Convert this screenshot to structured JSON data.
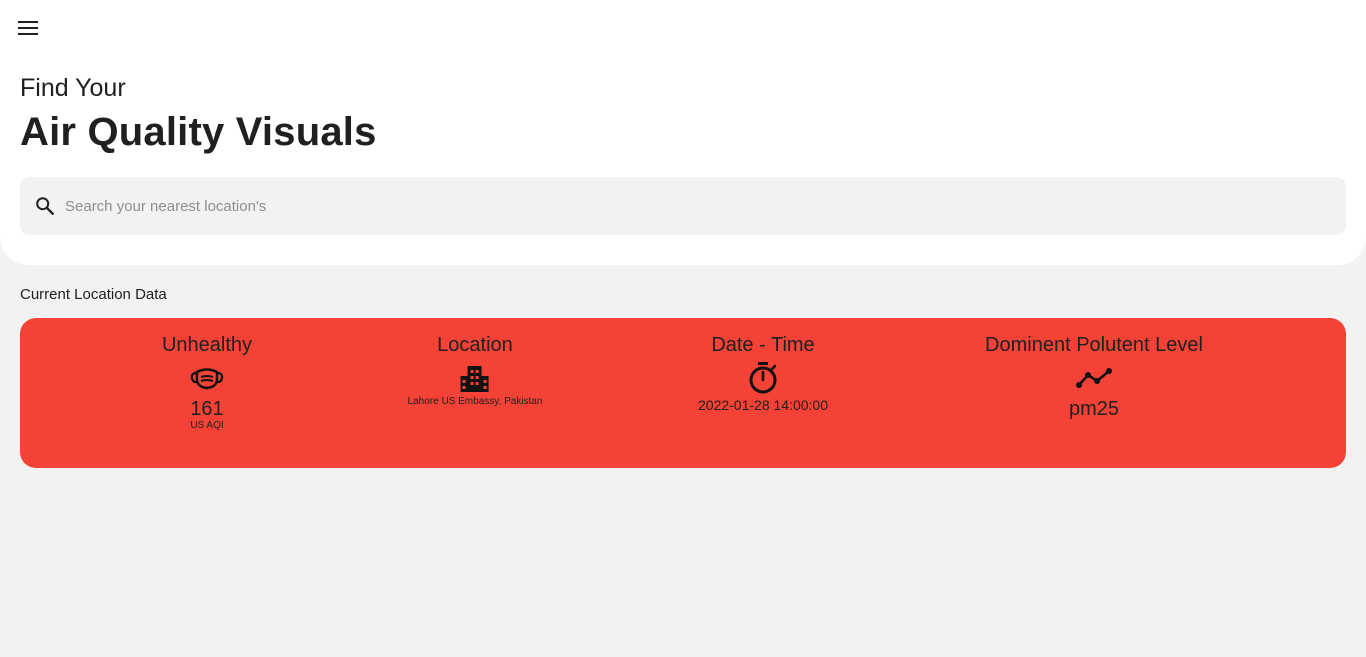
{
  "header": {
    "menu_icon": "menu-icon",
    "subtitle": "Find Your",
    "title": "Air Quality Visuals"
  },
  "search": {
    "icon": "search-icon",
    "placeholder": "Search your nearest location's",
    "value": ""
  },
  "section": {
    "label": "Current Location Data"
  },
  "card": {
    "background_color": "#f44336",
    "aqi": {
      "heading": "Unhealthy",
      "icon": "mask-icon",
      "value": "161",
      "unit": "US AQI"
    },
    "location": {
      "heading": "Location",
      "icon": "city-building-icon",
      "value": "Lahore US Embassy, Pakistan"
    },
    "datetime": {
      "heading": "Date - Time",
      "icon": "stopwatch-icon",
      "value": "2022-01-28 14:00:00"
    },
    "pollutant": {
      "heading": "Dominent Polutent Level",
      "icon": "trend-line-icon",
      "value": "pm25"
    }
  }
}
